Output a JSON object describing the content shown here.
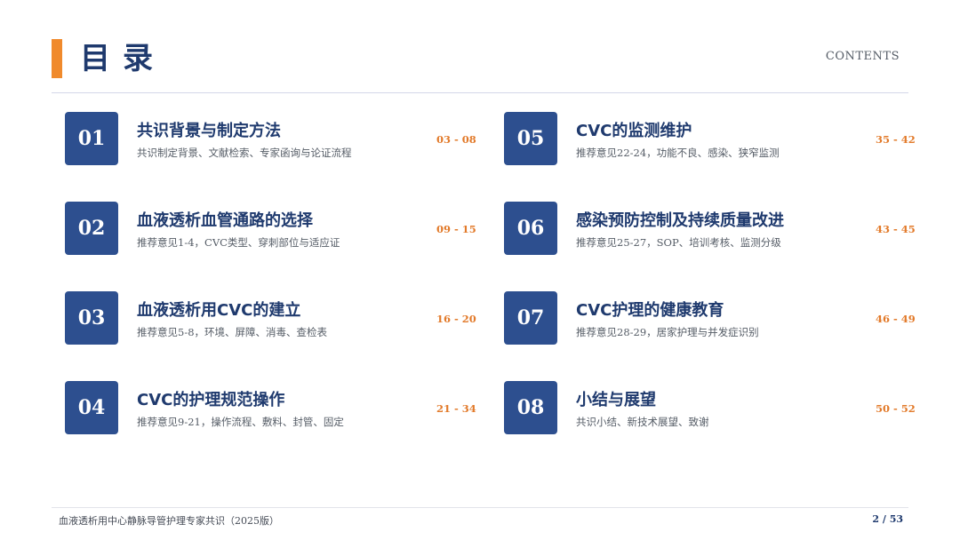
{
  "header": {
    "title": "目录",
    "subtitle": "CONTENTS"
  },
  "colors": {
    "accent": "#f08a2c",
    "badge": "#2d4f8f",
    "title": "#1f3a6e",
    "pages": "#e27a2a"
  },
  "items": [
    {
      "num": "01",
      "title": "共识背景与制定方法",
      "sub": "共识制定背景、文献检索、专家函询与论证流程",
      "pages": "03 - 08"
    },
    {
      "num": "02",
      "title": "血液透析血管通路的选择",
      "sub": "推荐意见1-4，CVC类型、穿刺部位与适应证",
      "pages": "09 - 15"
    },
    {
      "num": "03",
      "title": "血液透析用CVC的建立",
      "sub": "推荐意见5-8，环境、屏障、消毒、查检表",
      "pages": "16 - 20"
    },
    {
      "num": "04",
      "title": "CVC的护理规范操作",
      "sub": "推荐意见9-21，操作流程、敷料、封管、固定",
      "pages": "21 - 34"
    },
    {
      "num": "05",
      "title": "CVC的监测维护",
      "sub": "推荐意见22-24，功能不良、感染、狭窄监测",
      "pages": "35 - 42"
    },
    {
      "num": "06",
      "title": "感染预防控制及持续质量改进",
      "sub": "推荐意见25-27，SOP、培训考核、监测分级",
      "pages": "43 - 45"
    },
    {
      "num": "07",
      "title": "CVC护理的健康教育",
      "sub": "推荐意见28-29，居家护理与并发症识别",
      "pages": "46 - 49"
    },
    {
      "num": "08",
      "title": "小结与展望",
      "sub": "共识小结、新技术展望、致谢",
      "pages": "50 - 52"
    }
  ],
  "footer": {
    "doc_title": "血液透析用中心静脉导管护理专家共识（2025版）",
    "page_number": "2 / 53"
  }
}
